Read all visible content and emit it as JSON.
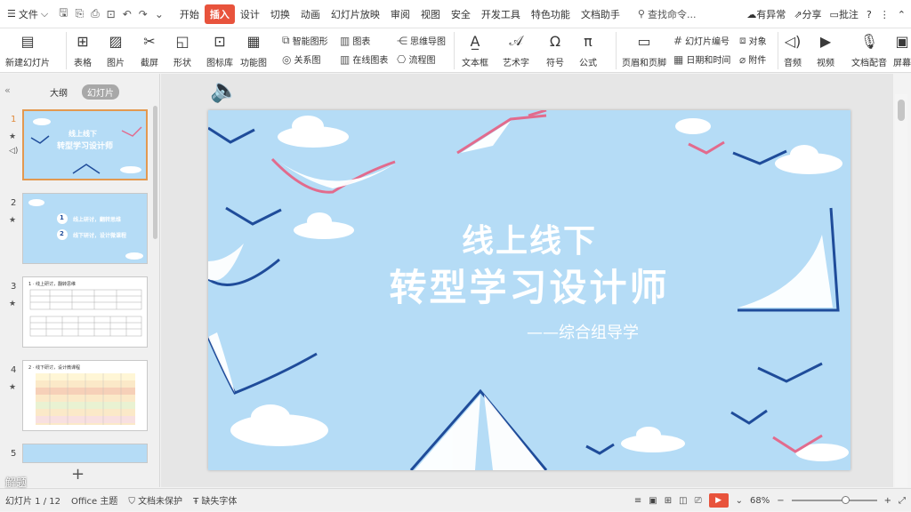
{
  "menubar": {
    "file_label": "文件",
    "tabs": [
      "开始",
      "插入",
      "设计",
      "切换",
      "动画",
      "幻灯片放映",
      "审阅",
      "视图",
      "安全",
      "开发工具",
      "特色功能",
      "文档助手"
    ],
    "search_label": "查找命令...",
    "abnormal_label": "有异常",
    "share_label": "分享",
    "comment_label": "批注"
  },
  "ribbon": {
    "new_slide": "新建幻灯片",
    "table": "表格",
    "picture": "图片",
    "screenshot": "截屏",
    "shape": "形状",
    "icon_lib": "图标库",
    "func_chart": "功能图",
    "smart_shape": "智能图形",
    "chart": "图表",
    "relation": "关系图",
    "online_chart": "在线图表",
    "mindmap": "思维导图",
    "flowchart": "流程图",
    "textbox": "文本框",
    "art_text": "艺术字",
    "symbol": "符号",
    "formula": "公式",
    "header_footer": "页眉和页脚",
    "slide_number": "幻灯片编号",
    "object": "对象",
    "datetime": "日期和时间",
    "attachment": "附件",
    "audio": "音频",
    "video": "视频",
    "voiceover": "文档配音",
    "screen_rec": "屏幕"
  },
  "left_panel": {
    "tab_outline": "大纲",
    "tab_slides": "幻灯片",
    "slide_numbers": [
      "1",
      "2",
      "3",
      "4",
      "5"
    ],
    "thumb1_line1": "线上线下",
    "thumb1_line2": "转型学习设计师",
    "thumb2_item1": "线上研讨，翻转思维",
    "thumb2_item2": "线下研讨，设计微课程",
    "thumb3_title": "1  ·  线上研讨，翻转思维",
    "thumb4_title": "2  ·  线下研讨，设计微课程"
  },
  "slide": {
    "title_line1": "线上线下",
    "title_line2": "转型学习设计师",
    "subtitle": "——综合组导学",
    "bg_color": "#b5dcf6"
  },
  "statusbar": {
    "slide_info": "幻灯片 1 / 12",
    "theme": "Office 主题",
    "doc_status": "文档未保护",
    "font_missing": "缺失字体",
    "zoom": "68%"
  },
  "watermark": "解题"
}
